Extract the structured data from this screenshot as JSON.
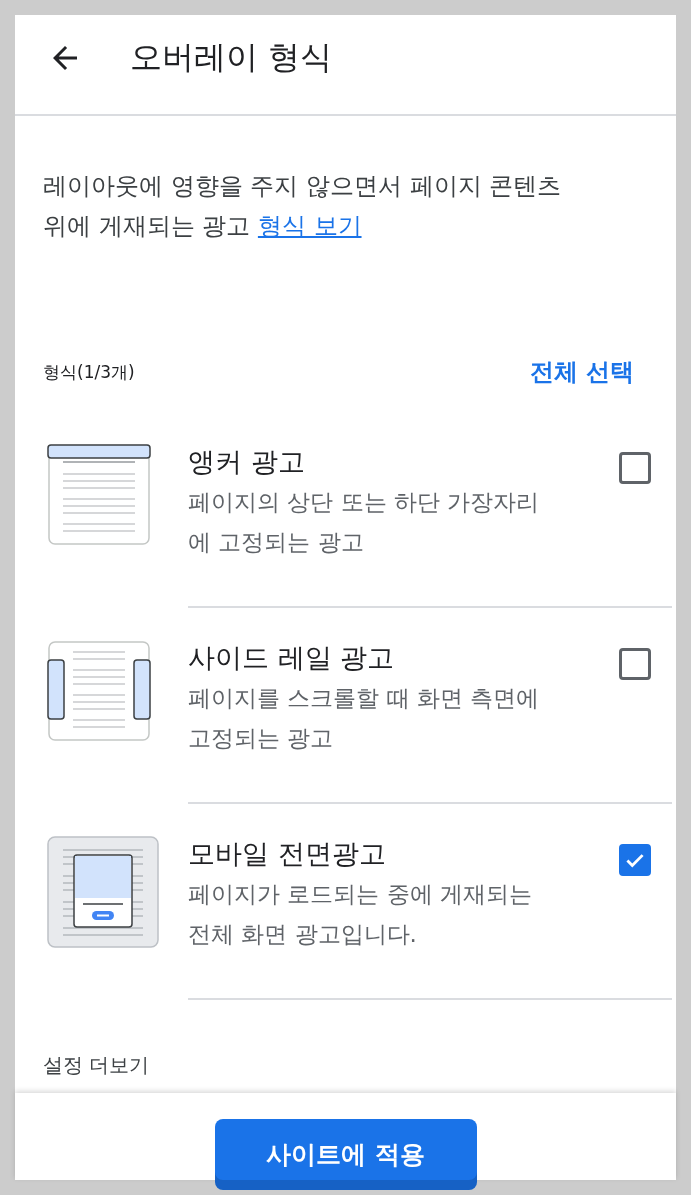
{
  "header": {
    "title": "오버레이 형식"
  },
  "description": {
    "text": "레이아웃에 영향을 주지 않으면서 페이지 콘텐츠 위에 게재되는 광고",
    "link": "형식 보기"
  },
  "formats": {
    "label": "형식(1/3개)",
    "select_all": "전체 선택",
    "items": [
      {
        "kind": "anchor",
        "title": "앵커 광고",
        "description": "페이지의 상단 또는 하단 가장자리에 고정되는 광고",
        "checked": false
      },
      {
        "kind": "side_rail",
        "title": "사이드 레일 광고",
        "description": "페이지를 스크롤할 때 화면 측면에 고정되는 광고",
        "checked": false
      },
      {
        "kind": "interstitial",
        "title": "모바일 전면광고",
        "description": "페이지가 로드되는 중에 게재되는 전체 화면 광고입니다.",
        "checked": true
      }
    ]
  },
  "more_settings": "설정 더보기",
  "apply_button": "사이트에 적용"
}
